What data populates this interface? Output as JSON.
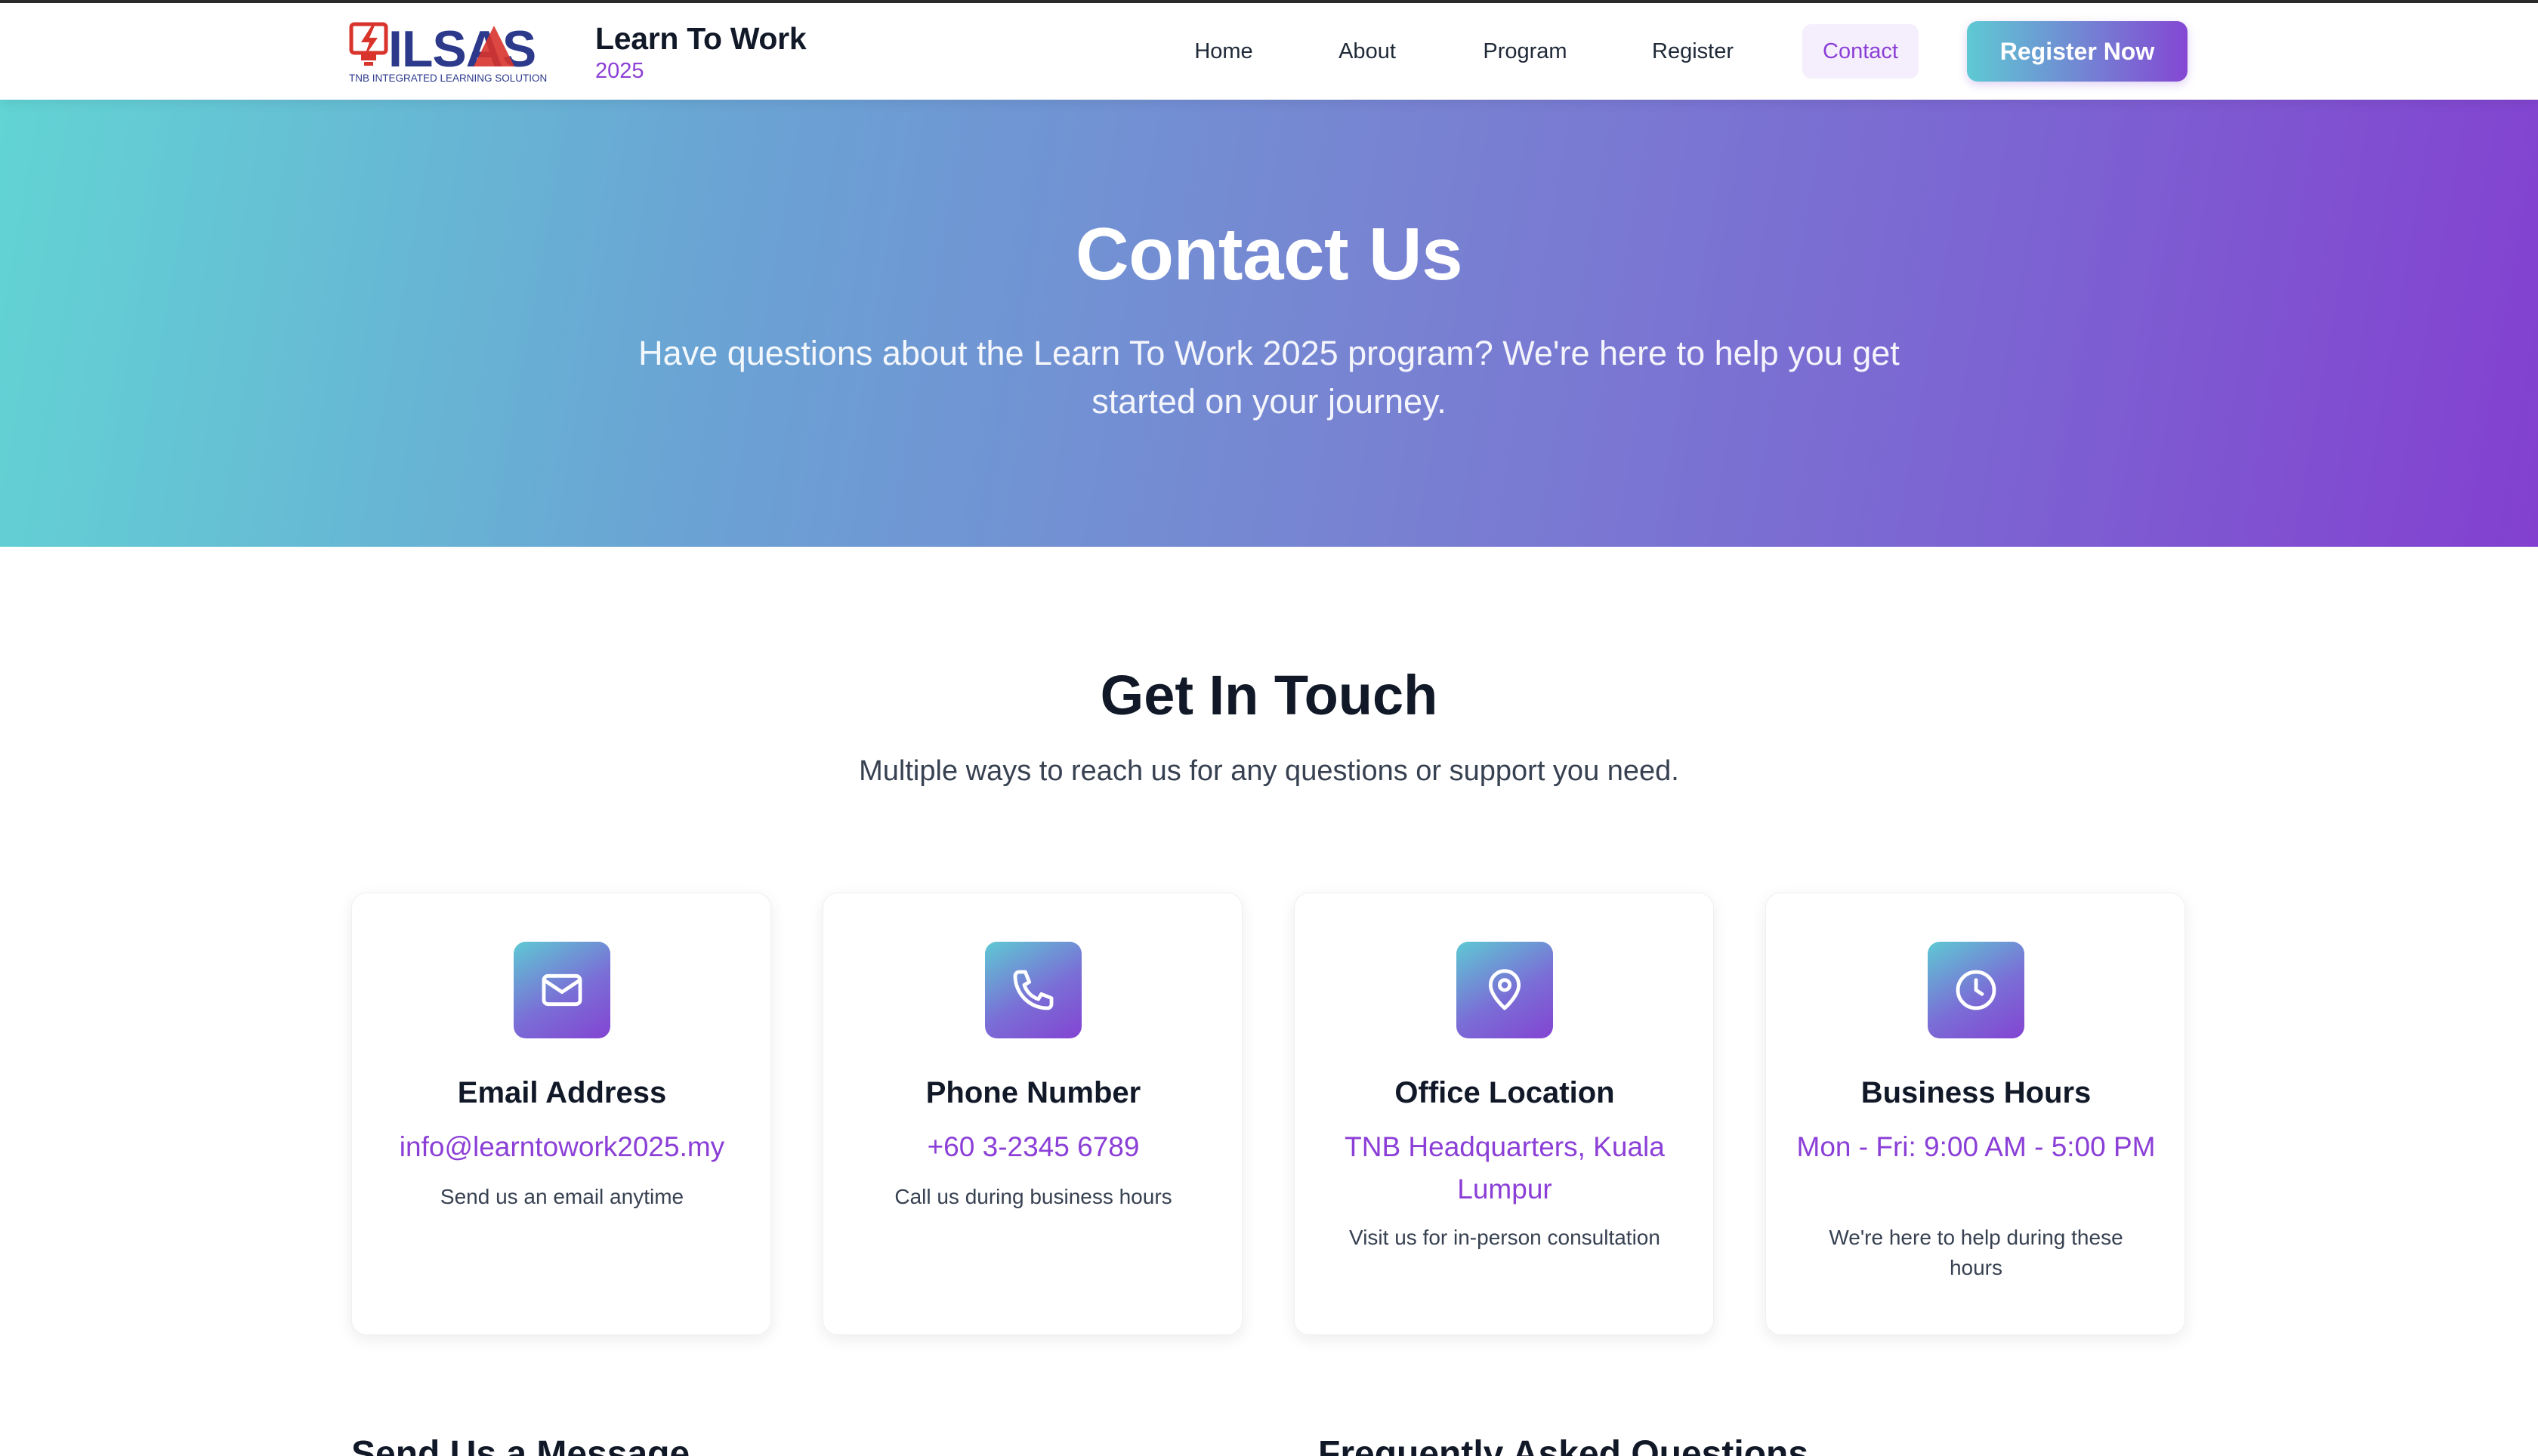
{
  "header": {
    "logo": {
      "wordmark": "ILSAS",
      "tagline": "TNB INTEGRATED LEARNING SOLUTION",
      "icon": "lightning-bolt-logo"
    },
    "brand_title": "Learn To Work",
    "brand_year": "2025",
    "nav": [
      {
        "label": "Home",
        "active": false
      },
      {
        "label": "About",
        "active": false
      },
      {
        "label": "Program",
        "active": false
      },
      {
        "label": "Register",
        "active": false
      },
      {
        "label": "Contact",
        "active": true
      }
    ],
    "cta_label": "Register Now"
  },
  "hero": {
    "title": "Contact Us",
    "subtitle": "Have questions about the Learn To Work 2025 program? We're here to help you get started on your journey."
  },
  "touch": {
    "title": "Get In Touch",
    "subtitle": "Multiple ways to reach us for any questions or support you need.",
    "cards": [
      {
        "icon": "mail-icon",
        "title": "Email Address",
        "value": "info@learntowork2025.my",
        "note": "Send us an email anytime"
      },
      {
        "icon": "phone-icon",
        "title": "Phone Number",
        "value": "+60 3-2345 6789",
        "note": "Call us during business hours"
      },
      {
        "icon": "map-pin-icon",
        "title": "Office Location",
        "value": "TNB Headquarters, Kuala Lumpur",
        "note": "Visit us for in-person consultation"
      },
      {
        "icon": "clock-icon",
        "title": "Business Hours",
        "value": "Mon - Fri: 9:00 AM - 5:00 PM",
        "note": "We're here to help during these hours"
      }
    ]
  },
  "lower": {
    "message_title": "Send Us a Message",
    "faq_title": "Frequently Asked Questions"
  },
  "colors": {
    "accent": "#8b3fd6",
    "gradient_start": "#5ec9d3",
    "gradient_end": "#8344d2",
    "text_dark": "#111827"
  }
}
